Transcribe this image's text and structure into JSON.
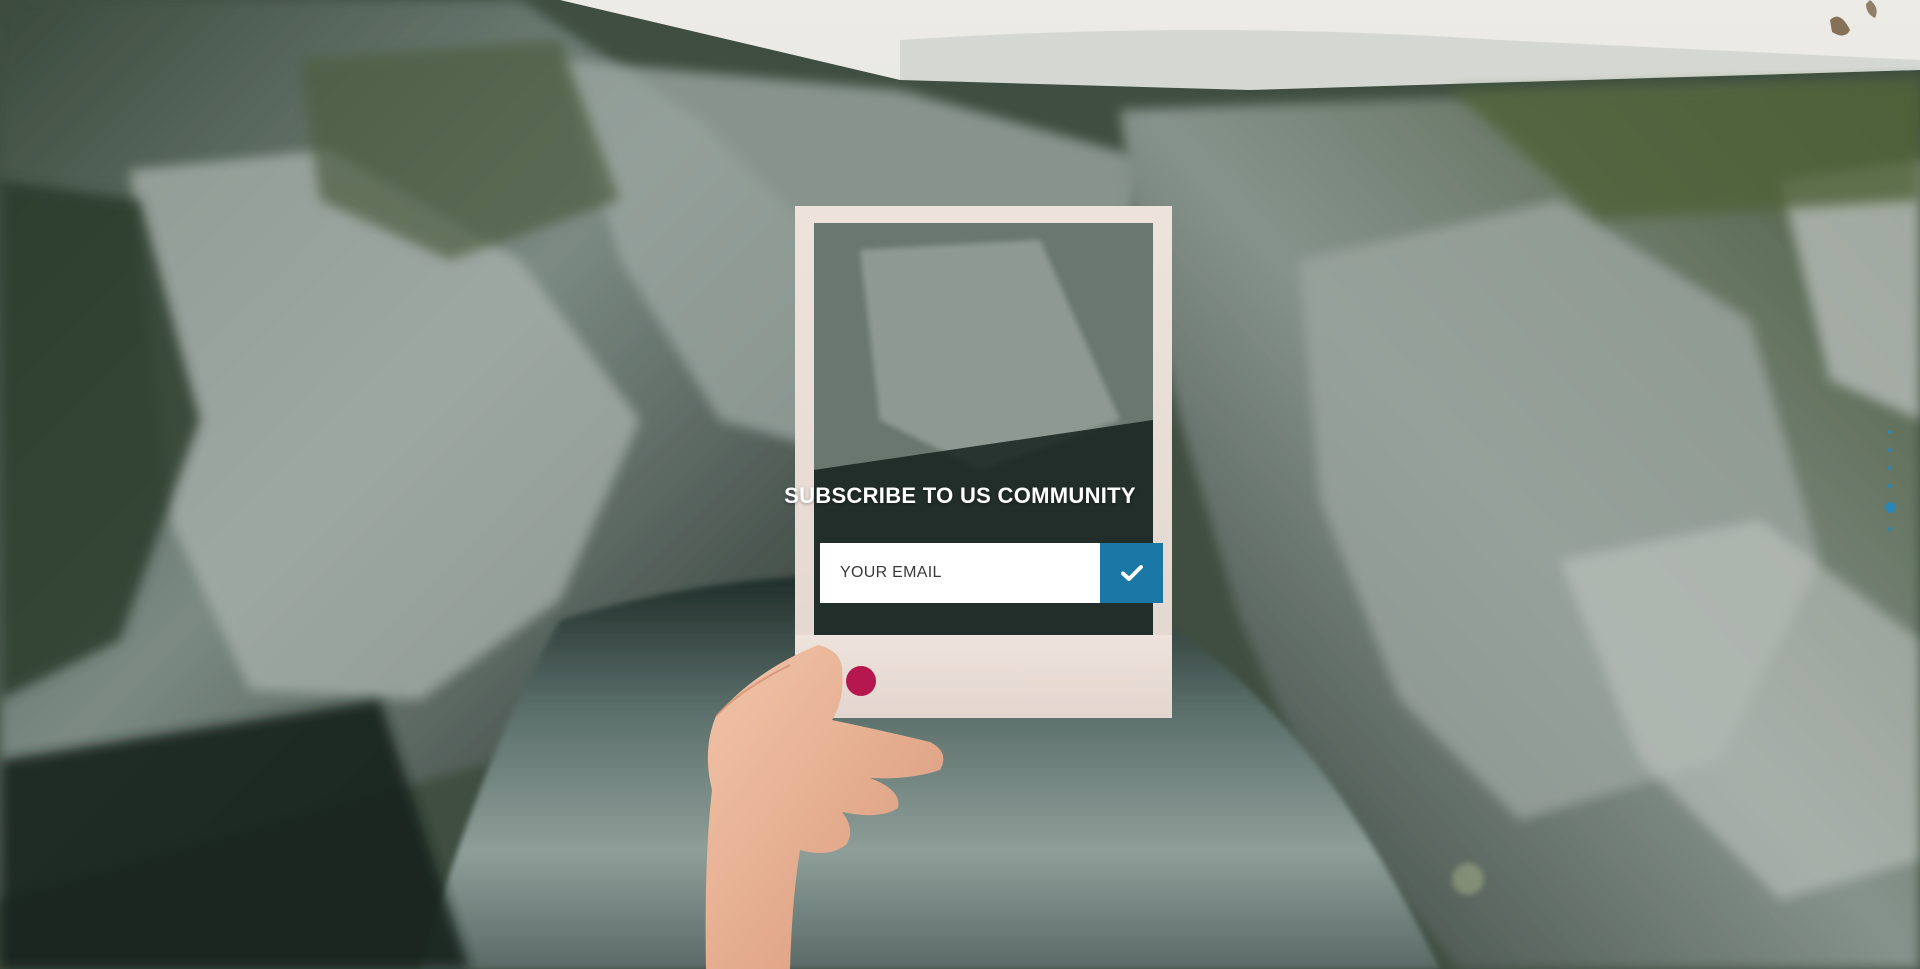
{
  "subscribe": {
    "title": "SUBSCRIBE TO US COMMUNITY",
    "email_placeholder": "YOUR EMAIL",
    "submit_icon": "check-icon"
  },
  "section_nav": {
    "dot_count": 6,
    "active_index": 4,
    "color": "#2a86b5"
  },
  "colors": {
    "accent": "#1b77a6",
    "frame": "#e9ddd6"
  }
}
